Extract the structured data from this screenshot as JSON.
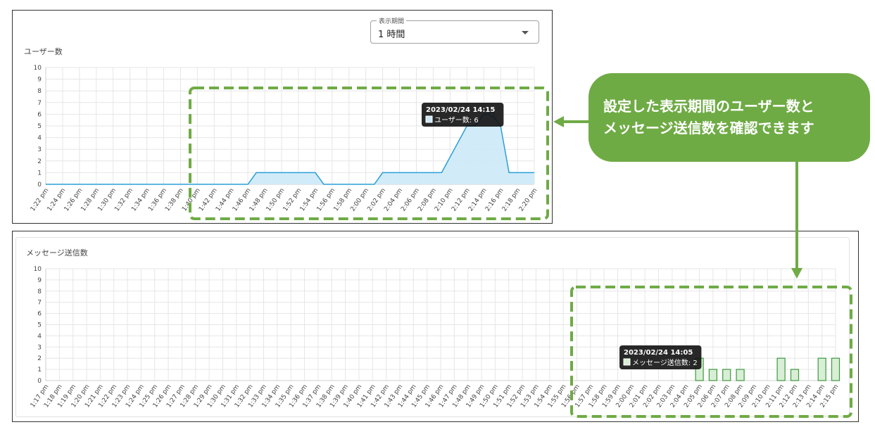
{
  "period_select": {
    "label": "表示期間",
    "value": "1 時間"
  },
  "callout": {
    "line1": "設定した表示期間のユーザー数と",
    "line2": "メッセージ送信数を確認できます"
  },
  "colors": {
    "accent_green": "#6fab45",
    "users_line": "#2a9fd6",
    "users_fill": "#cde9f8",
    "msg_bar_stroke": "#3d9a3d",
    "msg_bar_fill": "#d9eed6"
  },
  "chart_data": [
    {
      "type": "area",
      "title": "ユーザー数",
      "ylim": [
        0,
        10
      ],
      "yticks": [
        0,
        1,
        2,
        3,
        4,
        5,
        6,
        7,
        8,
        9,
        10
      ],
      "grid": true,
      "x_tick_labels": [
        "1:22 pm",
        "1:24 pm",
        "1:26 pm",
        "1:28 pm",
        "1:30 pm",
        "1:32 pm",
        "1:34 pm",
        "1:36 pm",
        "1:38 pm",
        "1:40 pm",
        "1:42 pm",
        "1:44 pm",
        "1:46 pm",
        "1:48 pm",
        "1:50 pm",
        "1:52 pm",
        "1:54 pm",
        "1:56 pm",
        "1:58 pm",
        "2:00 pm",
        "2:02 pm",
        "2:04 pm",
        "2:06 pm",
        "2:08 pm",
        "2:10 pm",
        "2:12 pm",
        "2:14 pm",
        "2:16 pm",
        "2:18 pm",
        "2:20 pm"
      ],
      "x_range": [
        "1:22 pm",
        "2:20 pm"
      ],
      "series": [
        {
          "points": [
            [
              "1:22 pm",
              0
            ],
            [
              "1:40 pm",
              0
            ],
            [
              "1:46 pm",
              0
            ],
            [
              "1:47 pm",
              1
            ],
            [
              "1:54 pm",
              1
            ],
            [
              "1:55 pm",
              0
            ],
            [
              "2:01 pm",
              0
            ],
            [
              "2:02 pm",
              1
            ],
            [
              "2:09 pm",
              1
            ],
            [
              "2:12 pm",
              5
            ],
            [
              "2:13 pm",
              5
            ],
            [
              "2:14 pm",
              6
            ],
            [
              "2:15 pm",
              6
            ],
            [
              "2:16 pm",
              5
            ],
            [
              "2:17 pm",
              1
            ],
            [
              "2:20 pm",
              1
            ]
          ]
        }
      ],
      "tooltip": {
        "title": "2023/02/24 14:15",
        "label": "ユーザー数: 6",
        "at": "2:15 pm",
        "value": 6
      }
    },
    {
      "type": "bar",
      "title": "メッセージ送信数",
      "ylim": [
        0,
        10
      ],
      "yticks": [
        0,
        1,
        2,
        3,
        4,
        5,
        6,
        7,
        8,
        9,
        10
      ],
      "grid": true,
      "categories": [
        "1:17 pm",
        "1:18 pm",
        "1:19 pm",
        "1:20 pm",
        "1:21 pm",
        "1:22 pm",
        "1:23 pm",
        "1:24 pm",
        "1:25 pm",
        "1:26 pm",
        "1:27 pm",
        "1:28 pm",
        "1:29 pm",
        "1:30 pm",
        "1:31 pm",
        "1:32 pm",
        "1:33 pm",
        "1:34 pm",
        "1:35 pm",
        "1:36 pm",
        "1:37 pm",
        "1:38 pm",
        "1:39 pm",
        "1:40 pm",
        "1:41 pm",
        "1:42 pm",
        "1:43 pm",
        "1:44 pm",
        "1:45 pm",
        "1:46 pm",
        "1:47 pm",
        "1:48 pm",
        "1:49 pm",
        "1:50 pm",
        "1:51 pm",
        "1:52 pm",
        "1:53 pm",
        "1:54 pm",
        "1:55 pm",
        "1:56 pm",
        "1:57 pm",
        "1:58 pm",
        "1:59 pm",
        "2:00 pm",
        "2:01 pm",
        "2:02 pm",
        "2:03 pm",
        "2:04 pm",
        "2:05 pm",
        "2:06 pm",
        "2:07 pm",
        "2:08 pm",
        "2:09 pm",
        "2:10 pm",
        "2:11 pm",
        "2:12 pm",
        "2:13 pm",
        "2:14 pm",
        "2:15 pm"
      ],
      "values": [
        0,
        0,
        0,
        0,
        0,
        0,
        0,
        0,
        0,
        0,
        0,
        0,
        0,
        0,
        0,
        0,
        0,
        0,
        0,
        0,
        0,
        0,
        0,
        0,
        0,
        0,
        0,
        0,
        0,
        0,
        0,
        0,
        0,
        0,
        0,
        0,
        0,
        0,
        0,
        0,
        0,
        0,
        0,
        0,
        0,
        0,
        0,
        0,
        2,
        1,
        1,
        1,
        0,
        0,
        2,
        1,
        0,
        2,
        2
      ],
      "tooltip": {
        "title": "2023/02/24 14:05",
        "label": "メッセージ送信数: 2",
        "at": "2:05 pm",
        "value": 2
      }
    }
  ]
}
